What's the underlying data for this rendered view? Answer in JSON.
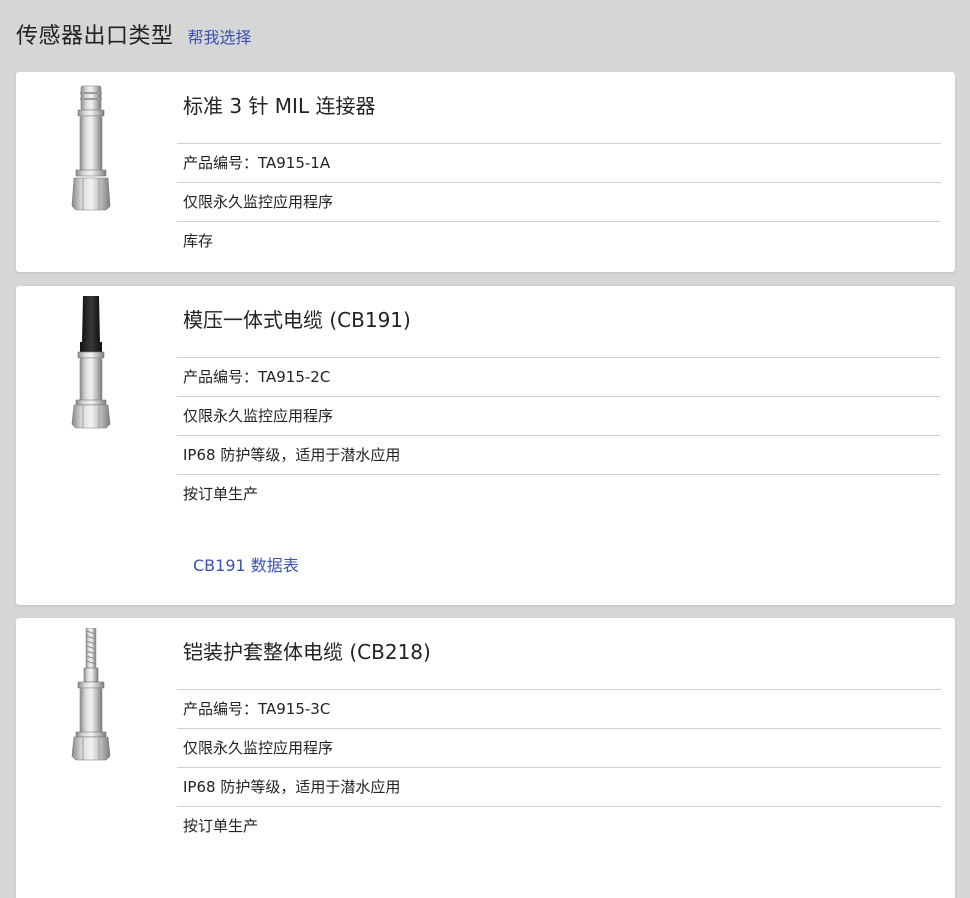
{
  "header": {
    "title": "传感器出口类型",
    "help_link": "帮我选择"
  },
  "products": [
    {
      "name": "标准 3 针 MIL 连接器",
      "image": "sensor-mil-connector-icon",
      "rows": [
        "产品编号：TA915-1A",
        "仅限永久监控应用程序",
        "库存"
      ]
    },
    {
      "name": "模压一体式电缆 (CB191)",
      "image": "sensor-molded-cable-icon",
      "rows": [
        "产品编号：TA915-2C",
        "仅限永久监控应用程序",
        "IP68 防护等级，适用于潜水应用",
        "按订单生产"
      ],
      "datasheet": "CB191 数据表"
    },
    {
      "name": "铠装护套整体电缆 (CB218)",
      "image": "sensor-armored-cable-icon",
      "rows": [
        "产品编号：TA915-3C",
        "仅限永久监控应用程序",
        "IP68 防护等级，适用于潜水应用",
        "按订单生产"
      ]
    }
  ],
  "colors": {
    "page_bg": "#d6d6d6",
    "card_bg": "#ffffff",
    "link": "#3b52b4",
    "divider": "#cfcfcf"
  }
}
